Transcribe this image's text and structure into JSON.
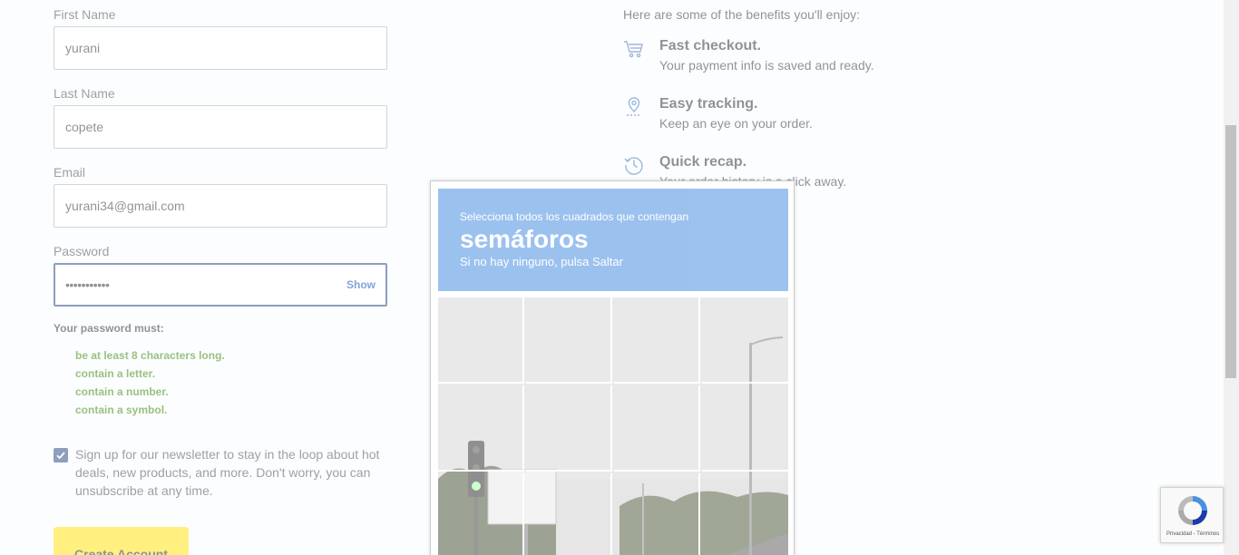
{
  "form": {
    "first_name": {
      "label": "First Name",
      "value": "yurani"
    },
    "last_name": {
      "label": "Last Name",
      "value": "copete"
    },
    "email": {
      "label": "Email",
      "value": "yurani34@gmail.com"
    },
    "password": {
      "label": "Password",
      "masked_value": "•••••••••••",
      "toggle_label": "Show"
    },
    "requirements": {
      "title": "Your password must:",
      "items": [
        "be at least 8 characters long.",
        "contain a letter.",
        "contain a number.",
        "contain a symbol."
      ]
    },
    "newsletter": {
      "checked": true,
      "text": "Sign up for our newsletter to stay in the loop about hot deals, new products, and more. Don't worry, you can unsubscribe at any time."
    },
    "submit_label": "Create Account"
  },
  "benefits": {
    "intro": "Here are some of the benefits you'll enjoy:",
    "items": [
      {
        "icon": "shopping-cart-icon",
        "title": "Fast checkout.",
        "desc": "Your payment info is saved and ready."
      },
      {
        "icon": "location-pin-icon",
        "title": "Easy tracking.",
        "desc": "Keep an eye on your order."
      },
      {
        "icon": "clock-history-icon",
        "title": "Quick recap.",
        "desc": "Your order history is a click away."
      }
    ]
  },
  "captcha": {
    "instruction": "Selecciona todos los cuadrados que contengan",
    "target": "semáforos",
    "hint": "Si no hay ninguno, pulsa Saltar"
  },
  "recaptcha_badge": {
    "footer": "Privacidad - Términos"
  },
  "colors": {
    "brand_blue": "#1d3c78",
    "link_blue": "#0046be",
    "success_green": "#318000",
    "button_yellow": "#ffe000",
    "captcha_blue": "#4a90e2"
  }
}
